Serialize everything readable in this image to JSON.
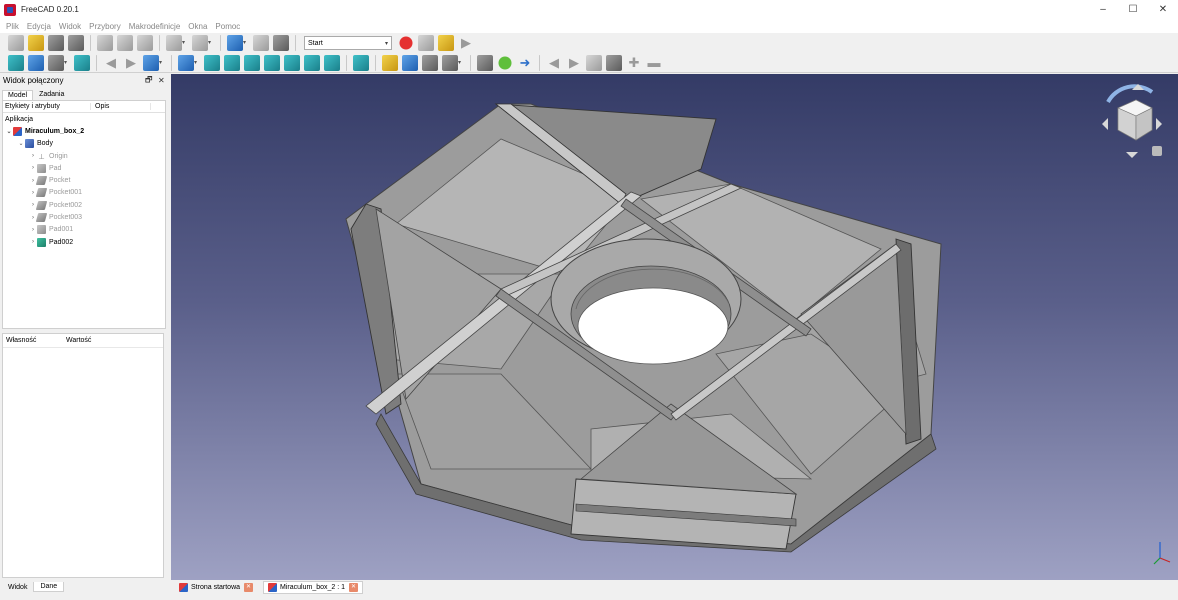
{
  "window": {
    "title": "FreeCAD 0.20.1",
    "minimize": "–",
    "maximize": "☐",
    "close": "✕"
  },
  "menu": [
    "Plik",
    "Edycja",
    "Widok",
    "Przybory",
    "Makrodefinicje",
    "Okna",
    "Pomoc"
  ],
  "toolbar": {
    "workbench": "Start"
  },
  "combo": {
    "title": "Widok połączony",
    "float": "🗗",
    "close": "✕",
    "tabs": [
      "Model",
      "Zadania"
    ],
    "tree_columns": [
      "Etykiety i atrybuty",
      "Opis"
    ],
    "application_label": "Aplikacja",
    "document": "Miraculum_box_2",
    "body": "Body",
    "features": [
      "Origin",
      "Pad",
      "Pocket",
      "Pocket001",
      "Pocket002",
      "Pocket003",
      "Pad001",
      "Pad002"
    ],
    "property_columns": [
      "Własność",
      "Wartość"
    ],
    "bottom_tabs": [
      "Widok",
      "Dane"
    ]
  },
  "doc_tabs": [
    "Strona startowa",
    "Miraculum_box_2 : 1"
  ],
  "colors": {
    "viewport_top": "#343b66",
    "viewport_bottom": "#9ea1c3",
    "model": "#a8a8a8"
  }
}
